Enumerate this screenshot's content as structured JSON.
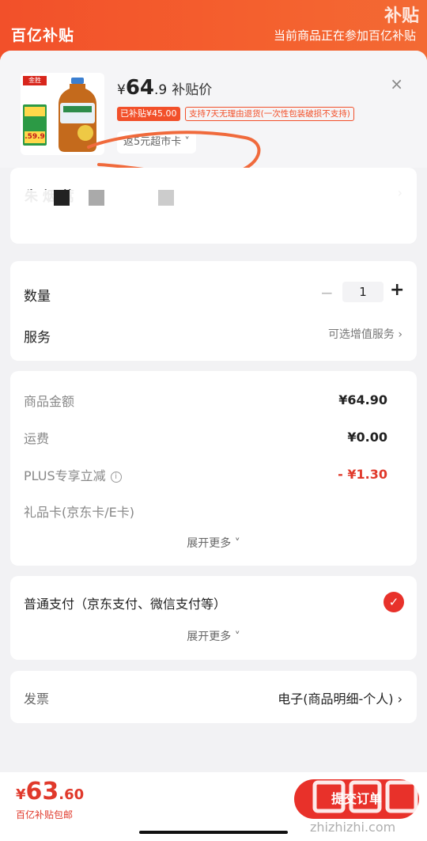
{
  "header": {
    "logo": "百亿补贴",
    "promo": "当前商品正在参加百亿补贴",
    "corner_badge": "补贴"
  },
  "product": {
    "brand_tag": "金胜",
    "side_tag": "5元",
    "side_price": ".59.9",
    "price_yen": "¥",
    "price_int": "64",
    "price_dec": ".9",
    "price_label": "补贴价",
    "subsidy_tag": "已补贴¥45.00",
    "return_tag": "支持7天无理由退货(一次性包装破损不支持)",
    "card_tag": "返5元超市卡 ˅",
    "close_icon": "×"
  },
  "address": {
    "name": "朱 烟 蒿",
    "chevron": "›"
  },
  "quantity": {
    "label": "数量",
    "minus": "−",
    "value": "1",
    "plus": "+"
  },
  "service": {
    "label": "服务",
    "value": "可选增值服务 ›"
  },
  "fees": {
    "items": [
      {
        "label": "商品金额",
        "value": "¥64.90"
      },
      {
        "label": "运费",
        "value": "¥0.00"
      },
      {
        "label": "PLUS专享立减",
        "value": "- ¥1.30"
      },
      {
        "label": "礼品卡(京东卡/E卡)",
        "value": ""
      }
    ],
    "expand": "展开更多 ˅"
  },
  "payment": {
    "label": "普通支付（京东支付、微信支付等）",
    "expand": "展开更多 ˅",
    "check": "✓"
  },
  "invoice": {
    "label": "发票",
    "value": "电子(商品明细-个人) ›"
  },
  "footer": {
    "total_yen": "¥",
    "total_int": "63",
    "total_dec": ".60",
    "total_sub": "百亿补贴包邮",
    "submit": "提交订单",
    "watermark": "zhizhizhi.com"
  },
  "colors": {
    "accent": "#e8312a",
    "banner": "#f2502a"
  }
}
